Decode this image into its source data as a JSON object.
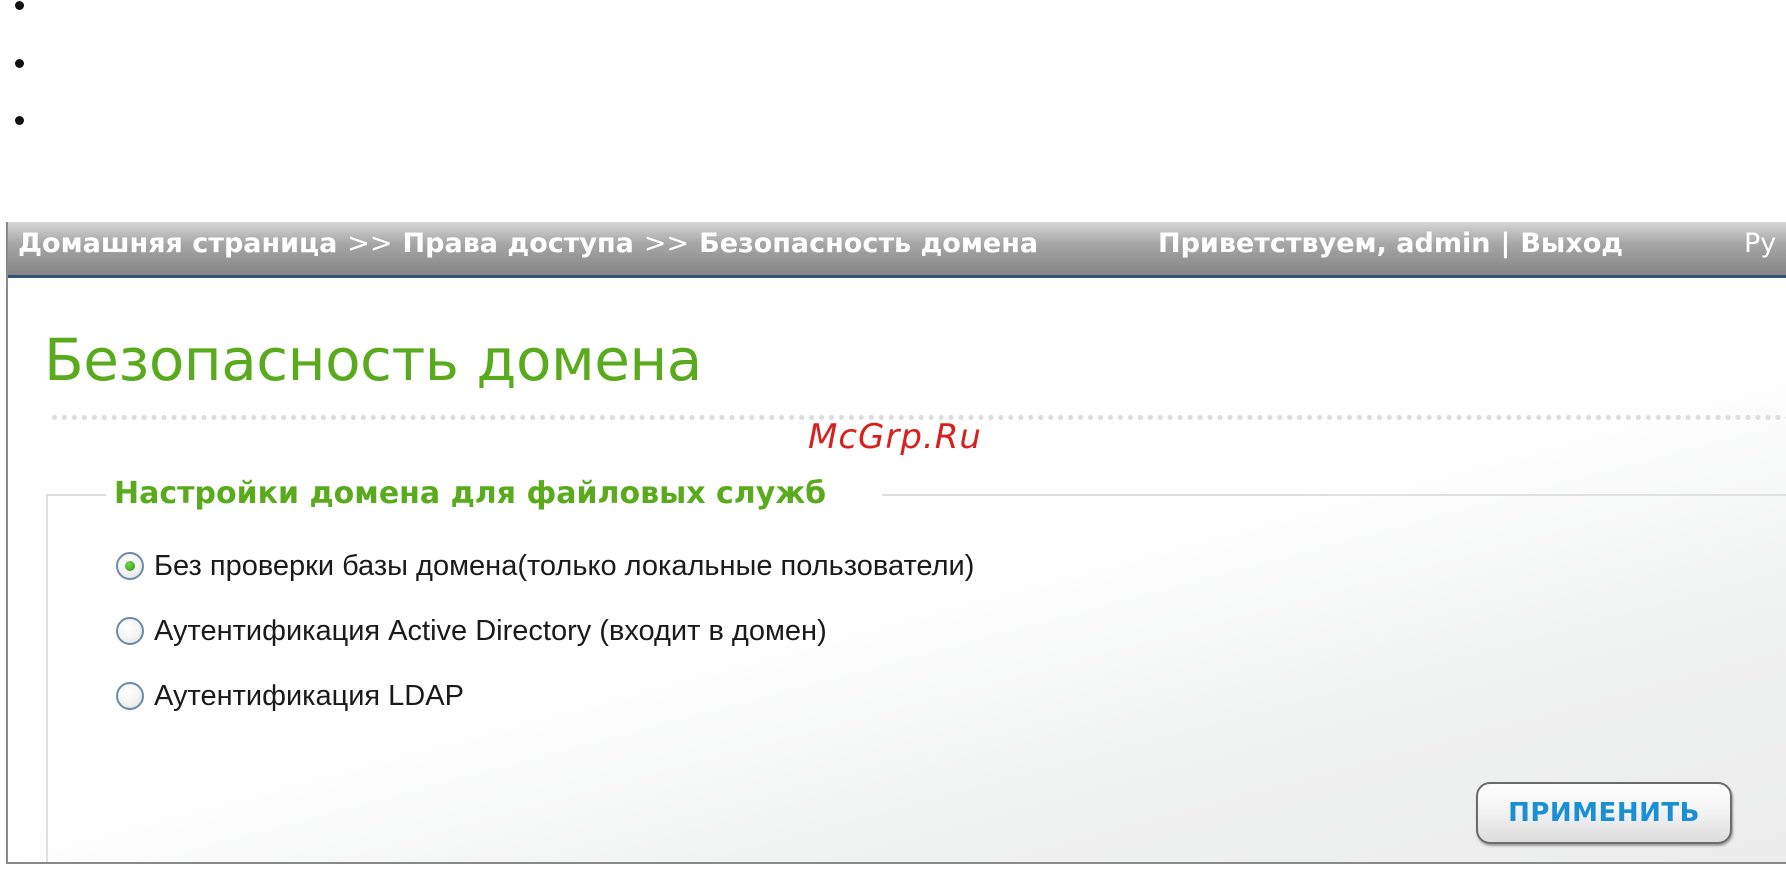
{
  "breadcrumb": {
    "items": [
      "Домашняя страница",
      "Права доступа",
      "Безопасность домена"
    ],
    "separator": ">>"
  },
  "header": {
    "greeting": "Приветствуем,",
    "username": "admin",
    "divider": "|",
    "logout": "Выход",
    "language": "Ру"
  },
  "page": {
    "title": "Безопасность домена",
    "watermark": "McGrp.Ru"
  },
  "domain_settings": {
    "group_title": "Настройки домена для файловых служб",
    "selected": "no_domain_check",
    "options": [
      {
        "id": "no_domain_check",
        "label": "Без проверки базы домена(только локальные пользователи)",
        "checked": true
      },
      {
        "id": "active_directory",
        "label": "Аутентификация Active Directory (входит в домен)",
        "checked": false
      },
      {
        "id": "ldap",
        "label": "Аутентификация LDAP",
        "checked": false
      }
    ]
  },
  "actions": {
    "apply_label": "ПРИМЕНИТЬ"
  },
  "colors": {
    "accent_green": "#5aaa1e",
    "button_text_blue": "#1a8fd4",
    "header_bar": "#848484",
    "watermark_red": "#d8201e"
  }
}
